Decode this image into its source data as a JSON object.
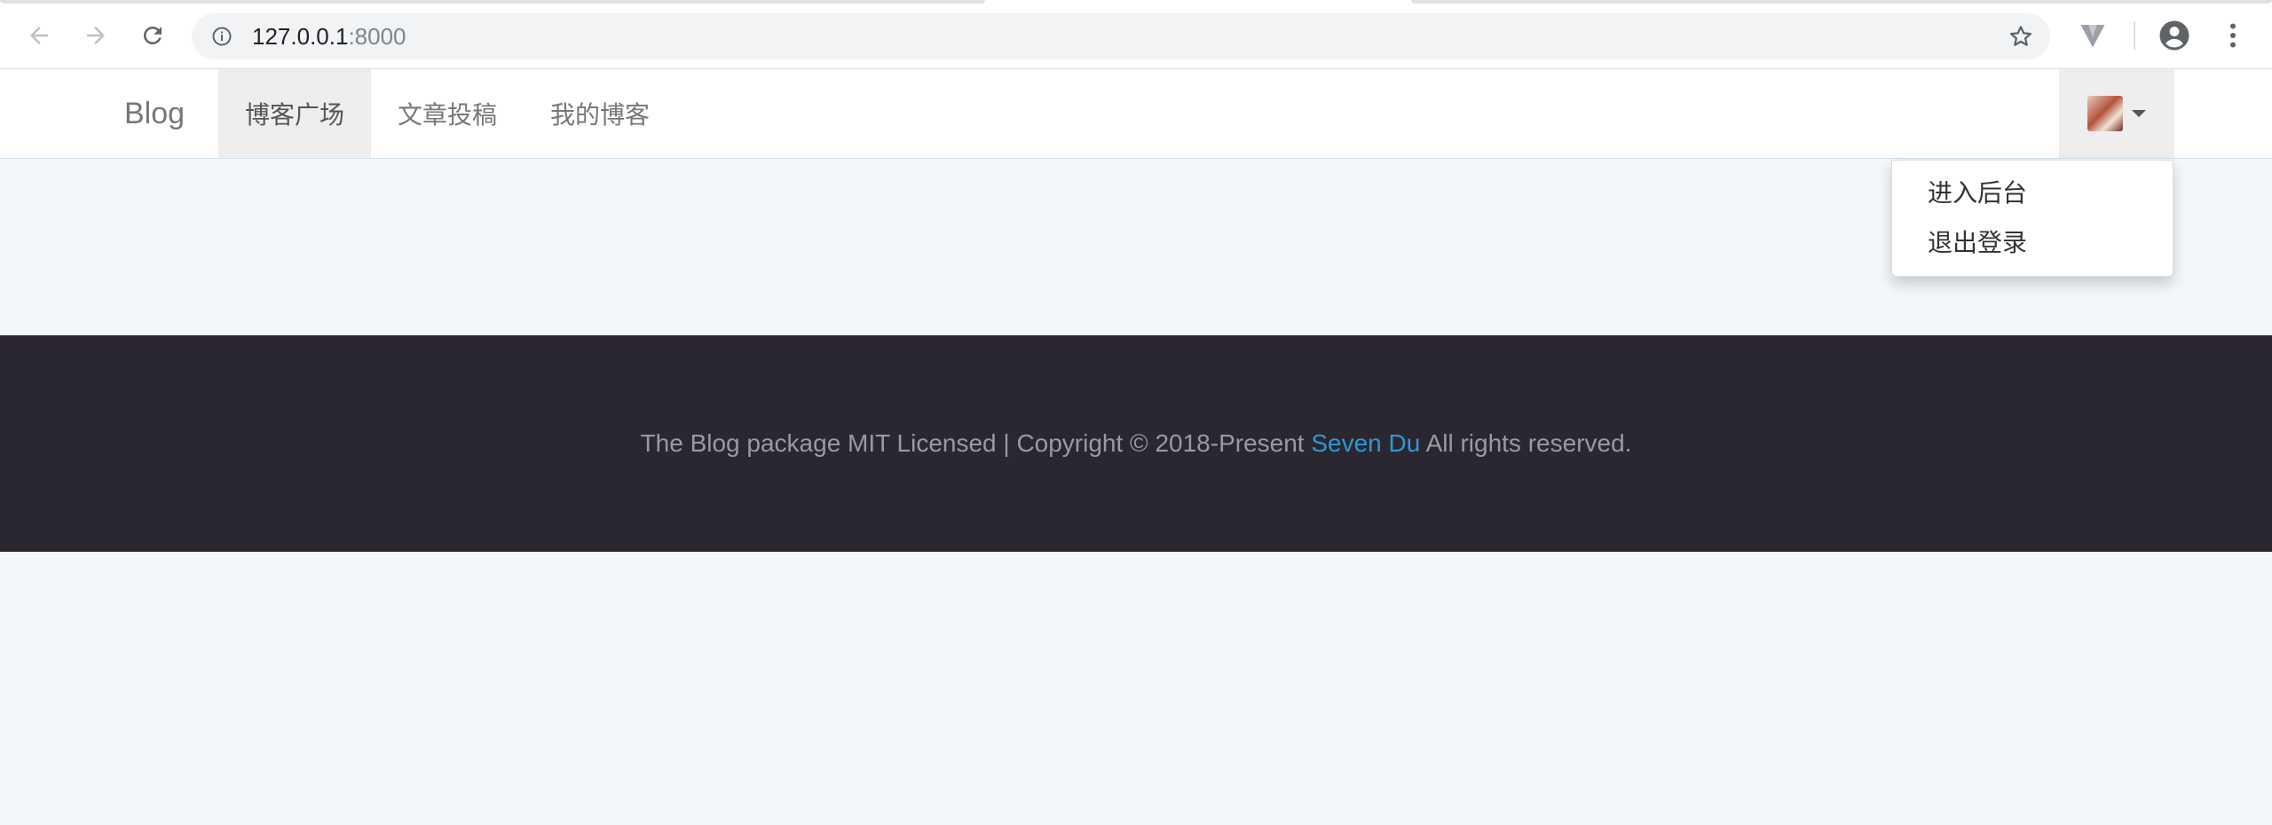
{
  "browser": {
    "url_host": "127.0.0.1",
    "url_port": ":8000",
    "icons": [
      "back-arrow-icon",
      "forward-arrow-icon",
      "reload-icon",
      "info-icon",
      "star-icon",
      "extension-v-icon",
      "account-icon",
      "menu-dots-icon"
    ]
  },
  "navbar": {
    "brand": "Blog",
    "items": [
      {
        "label": "博客广场",
        "active": true
      },
      {
        "label": "文章投稿",
        "active": false
      },
      {
        "label": "我的博客",
        "active": false
      }
    ]
  },
  "user_menu": {
    "items": [
      {
        "label": "进入后台"
      },
      {
        "label": "退出登录"
      }
    ]
  },
  "footer": {
    "text_before": "The Blog package MIT Licensed | Copyright © 2018-Present ",
    "author": "Seven Du",
    "text_after": " All rights reserved."
  },
  "colors": {
    "page_background": "#f4f7fa",
    "footer_background": "#2b2730",
    "link": "#3097d1",
    "active_nav_background": "#eeeeee"
  }
}
